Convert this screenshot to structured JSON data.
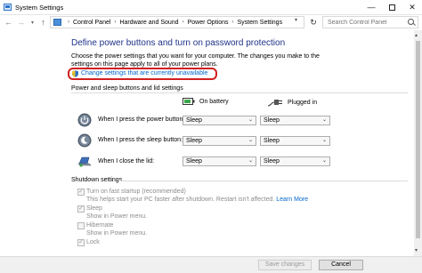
{
  "window": {
    "title": "System Settings",
    "minimize": "—",
    "close": "✕"
  },
  "nav": {
    "back": "←",
    "forward": "→",
    "recent": "▾",
    "up": "↑"
  },
  "address": {
    "breadcrumbs": [
      "Control Panel",
      "Hardware and Sound",
      "Power Options",
      "System Settings"
    ],
    "separator": "›",
    "dropdown": "▾",
    "refresh": "↻"
  },
  "search": {
    "placeholder": "Search Control Panel"
  },
  "scrollbar": {
    "up": "▴",
    "down": "▾"
  },
  "main": {
    "heading": "Define power buttons and turn on password protection",
    "description": "Choose the power settings that you want for your computer. The changes you make to the settings on this page apply to all of your power plans.",
    "change_link": "Change settings that are currently unavailable"
  },
  "power_section": {
    "title": "Power and sleep buttons and lid settings",
    "col_battery": "On battery",
    "col_plugged": "Plugged in",
    "rows": [
      {
        "label": "When I press the power button:",
        "battery": "Sleep",
        "plugged": "Sleep"
      },
      {
        "label": "When I press the sleep button:",
        "battery": "Sleep",
        "plugged": "Sleep"
      },
      {
        "label": "When I close the lid:",
        "battery": "Sleep",
        "plugged": "Sleep"
      }
    ],
    "dropdown_arrow": "⌄"
  },
  "shutdown_section": {
    "title": "Shutdown settings",
    "fast_startup": {
      "label": "Turn on fast startup (recommended)",
      "desc": "This helps start your PC faster after shutdown. Restart isn't affected.",
      "link": "Learn More",
      "checked": true
    },
    "sleep": {
      "label": "Sleep",
      "desc": "Show in Power menu.",
      "checked": true
    },
    "hibernate": {
      "label": "Hibernate",
      "desc": "Show in Power menu.",
      "checked": false
    },
    "lock": {
      "label": "Lock",
      "checked": true
    }
  },
  "footer": {
    "save": "Save changes",
    "cancel": "Cancel"
  },
  "colors": {
    "heading": "#1e3287",
    "link": "#0066cc",
    "highlight": "#d21f1f",
    "disabled_text": "#8c8c8c"
  }
}
